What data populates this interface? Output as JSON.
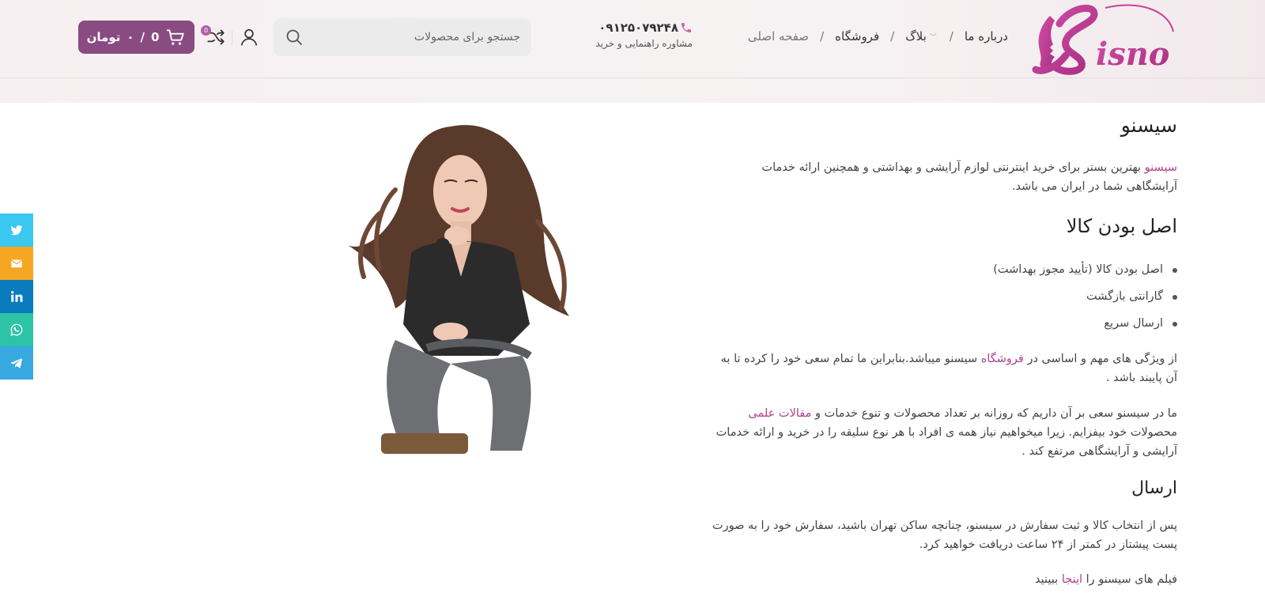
{
  "header": {
    "logo_text": "Sisno",
    "nav": {
      "home": "صفحه اصلی",
      "shop": "فروشگاه",
      "blog": "بلاگ",
      "about": "درباره ما",
      "separator": "/"
    },
    "phone": {
      "number": "۰۹۱۲۵۰۷۹۲۴۸",
      "subtitle": "مشاوره راهنمایی و خرید"
    },
    "search": {
      "placeholder": "جستجو برای محصولات"
    },
    "compare_count": "0",
    "cart": {
      "count": "0",
      "separator": "/",
      "amount": "۰",
      "currency": "تومان"
    }
  },
  "content": {
    "title": "سیسنو",
    "intro_link": "سیسنو",
    "intro_text": " بهترین بستر برای خرید اینترنتی لوازم آرایشی و بهداشتی و همچنین ارائه خدمات آرایشگاهی شما در ایران می باشد.",
    "authentic_heading": "اصل بودن کالا",
    "features": [
      "اصل بودن کالا (تأیید مجوز بهداشت)",
      "گارانتی بازگشت",
      "ارسال سریع"
    ],
    "features_text_before": "از ویژگی های مهم و اساسی در ",
    "features_link": "فروشگاه",
    "features_text_after": " سیسنو میباشد.بنابراین ما تمام سعی خود را کرده تا به آن پایبند باشد .",
    "mission_text_before": "ما در سیسنو سعی بر آن داریم که روزانه بر تعداد محصولات و تنوع خدمات و ",
    "mission_link": "مقالات علمی",
    "mission_text_after": " محصولات خود بیفزایم.  زیرا میخواهیم نیاز همه ی افراد با هر نوع سلیقه را در خرید و ارائه خدمات آرایشی و آرایشگاهی مرتفع کند .",
    "shipping_heading": "ارسال",
    "shipping_text": "پس از انتخاب کالا و ثبت سفارش در سیسنو، چنانچه ساکن تهران باشید، سفارش خود را به صورت پست پیشتاز در کمتر از ۲۴ ساعت دریافت خواهید کرد.",
    "film_text_before": "فیلم های سیسنو را ",
    "film_link": "اینجا",
    "film_text_after": " ببینید"
  },
  "social": [
    {
      "name": "twitter",
      "color": "#3ac7f0"
    },
    {
      "name": "email",
      "color": "#f5a623"
    },
    {
      "name": "linkedin",
      "color": "#0a7bbd"
    },
    {
      "name": "whatsapp",
      "color": "#2cc3a7"
    },
    {
      "name": "telegram",
      "color": "#37a8e0"
    }
  ],
  "colors": {
    "accent": "#b1408f",
    "cart_bg": "#8a4a82",
    "logo": "#c7429b"
  }
}
